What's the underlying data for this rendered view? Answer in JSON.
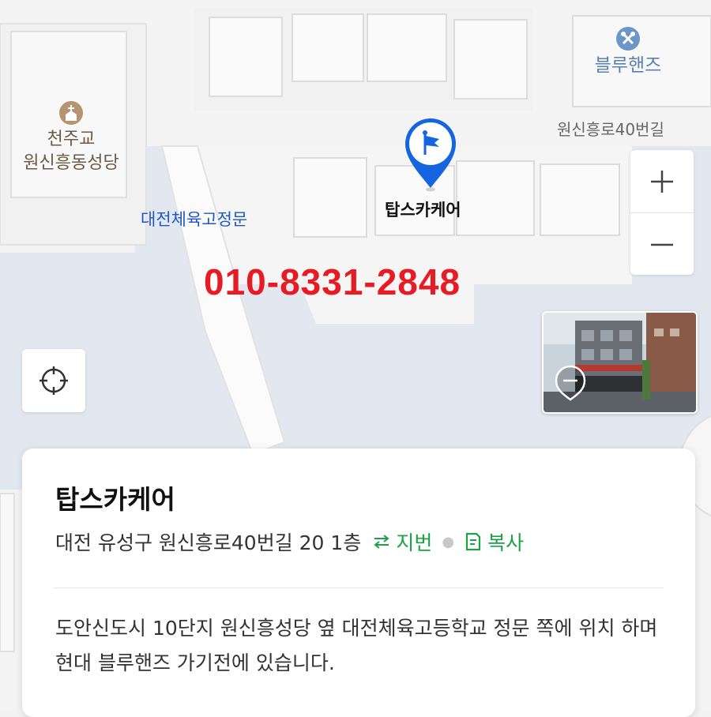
{
  "map": {
    "pois": {
      "church_line1": "천주교",
      "church_line2": "원신흥동성당",
      "church_icon": "church-icon",
      "blue_hands": "블루핸즈",
      "blue_hands_icon": "wrench-icon"
    },
    "road_label": "원신흥로40번길",
    "gate_label": "대전체육고정문",
    "place_label": "탑스카케어",
    "phone_overlay": "010-8331-2848",
    "colors": {
      "phone": "#e61b23",
      "marker": "#1565e0",
      "gate_label": "#1f57c7",
      "green_link": "#1ea046"
    }
  },
  "controls": {
    "zoom_in": "+",
    "zoom_out": "−",
    "locate_icon": "crosshair-icon"
  },
  "card": {
    "title": "탑스카케어",
    "address": "대전 유성구 원신흥로40번길 20 1층",
    "jibun_label": "지번",
    "copy_label": "복사",
    "description": "도안신도시 10단지 원신흥성당 옆 대전체육고등학교 정문 쪽에 위치 하며 현대 블루핸즈 가기전에 있습니다."
  }
}
